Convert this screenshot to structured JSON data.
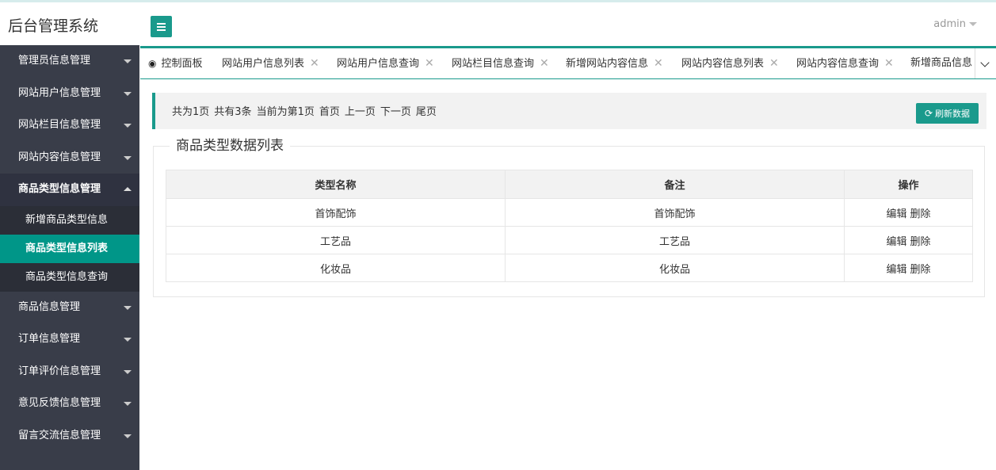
{
  "app": {
    "title": "后台管理系统",
    "user": "admin"
  },
  "sidebar": {
    "groups_top": [
      {
        "label": "管理员信息管理"
      },
      {
        "label": "网站用户信息管理"
      },
      {
        "label": "网站栏目信息管理"
      },
      {
        "label": "网站内容信息管理"
      }
    ],
    "open_group": {
      "label": "商品类型信息管理",
      "items": [
        {
          "label": "新增商品类型信息"
        },
        {
          "label": "商品类型信息列表"
        },
        {
          "label": "商品类型信息查询"
        }
      ]
    },
    "groups_bottom": [
      {
        "label": "商品信息管理"
      },
      {
        "label": "订单信息管理"
      },
      {
        "label": "订单评价信息管理"
      },
      {
        "label": "意见反馈信息管理"
      },
      {
        "label": "留言交流信息管理"
      }
    ]
  },
  "tabs": [
    {
      "label": "控制面板"
    },
    {
      "label": "网站用户信息列表"
    },
    {
      "label": "网站用户信息查询"
    },
    {
      "label": "网站栏目信息查询"
    },
    {
      "label": "新增网站内容信息"
    },
    {
      "label": "网站内容信息列表"
    },
    {
      "label": "网站内容信息查询"
    },
    {
      "label": "新增商品信息"
    }
  ],
  "pager": {
    "total_pages": "共为1页",
    "total_items": "共有3条",
    "current": "当前为第1页",
    "first": "首页",
    "prev": "上一页",
    "next": "下一页",
    "last": "尾页",
    "refresh": "刷新数据"
  },
  "list": {
    "title": "商品类型数据列表",
    "columns": [
      "类型名称",
      "备注",
      "操作"
    ],
    "rows": [
      {
        "name": "首饰配饰",
        "note": "首饰配饰"
      },
      {
        "name": "工艺品",
        "note": "工艺品"
      },
      {
        "name": "化妆品",
        "note": "化妆品"
      }
    ],
    "edit": "编辑",
    "delete": "删除"
  }
}
